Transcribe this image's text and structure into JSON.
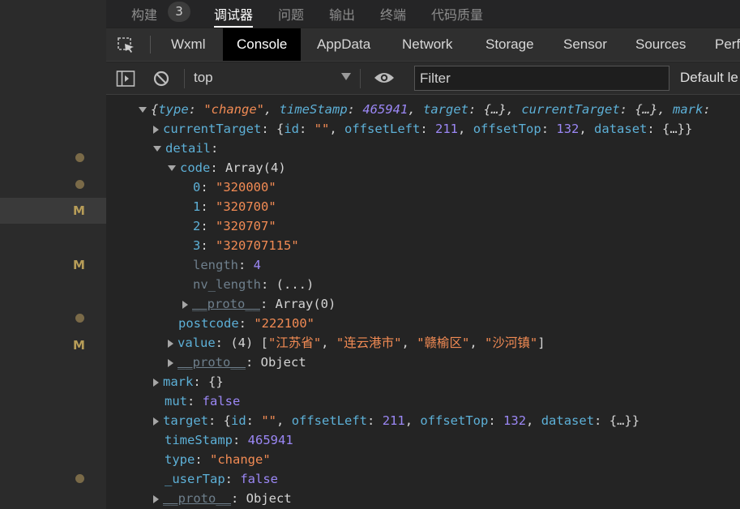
{
  "gutter": {
    "markers": [
      "M",
      "M",
      "M"
    ]
  },
  "topbar": {
    "tabs": [
      {
        "label": "构建",
        "badge": "3"
      },
      {
        "label": "调试器"
      },
      {
        "label": "问题"
      },
      {
        "label": "输出"
      },
      {
        "label": "终端"
      },
      {
        "label": "代码质量"
      }
    ],
    "active": "调试器"
  },
  "panel_tabs": {
    "tabs": [
      "Wxml",
      "Console",
      "AppData",
      "Network",
      "Storage",
      "Sensor",
      "Sources",
      "Perf"
    ],
    "active": "Console"
  },
  "toolbar": {
    "context": "top",
    "filter_placeholder": "Filter",
    "levels": "Default le"
  },
  "console": {
    "summary": {
      "t1": "{",
      "k1": "type",
      "c1": ": ",
      "v1": "\"change\"",
      "c2": ", ",
      "k2": "timeStamp",
      "c3": ": ",
      "v2": "465941",
      "c4": ", ",
      "k3": "target",
      "c5": ": {…}, ",
      "k4": "currentTarget",
      "c6": ": {…}, ",
      "k5": "mark",
      "c7": ":"
    },
    "currentTarget": {
      "key": "currentTarget",
      "p1": ": {",
      "k1": "id",
      "p2": ": ",
      "v1": "\"\"",
      "p3": ", ",
      "k2": "offsetLeft",
      "p4": ": ",
      "v2": "211",
      "p5": ", ",
      "k3": "offsetTop",
      "p6": ": ",
      "v3": "132",
      "p7": ", ",
      "k4": "dataset",
      "p8": ": {…}}"
    },
    "detail_key": "detail",
    "detail_colon": ":",
    "code_key": "code",
    "code_val": ": Array(4)",
    "code_items": [
      {
        "idx": "0",
        "val": "\"320000\""
      },
      {
        "idx": "1",
        "val": "\"320700\""
      },
      {
        "idx": "2",
        "val": "\"320707\""
      },
      {
        "idx": "3",
        "val": "\"320707115\""
      }
    ],
    "length_key": "length",
    "length_val": "4",
    "nv_key": "nv_length",
    "nv_val": "(...)",
    "proto_key": "__proto__",
    "proto_arr": ": Array(0)",
    "postcode_key": "postcode",
    "postcode_val": "\"222100\"",
    "value_key": "value",
    "value_prefix": ": (4) [",
    "value_items": [
      "\"江苏省\"",
      "\"连云港市\"",
      "\"赣榆区\"",
      "\"沙河镇\""
    ],
    "value_suffix": "]",
    "proto_obj": ": Object",
    "mark_key": "mark",
    "mark_val": ": {}",
    "mut_key": "mut",
    "mut_val": "false",
    "target": {
      "key": "target",
      "p1": ": {",
      "k1": "id",
      "p2": ": ",
      "v1": "\"\"",
      "p3": ", ",
      "k2": "offsetLeft",
      "p4": ": ",
      "v2": "211",
      "p5": ", ",
      "k3": "offsetTop",
      "p6": ": ",
      "v3": "132",
      "p7": ", ",
      "k4": "dataset",
      "p8": ": {…}}"
    },
    "ts_key": "timeStamp",
    "ts_val": "465941",
    "type_key": "type",
    "type_val": "\"change\"",
    "usertap_key": "_userTap",
    "usertap_val": "false",
    "colon": ": ",
    "comma": ", "
  },
  "colors": {
    "key": "#5db0d7",
    "string": "#f28b54",
    "number": "#9b87f5",
    "background": "#242424"
  }
}
